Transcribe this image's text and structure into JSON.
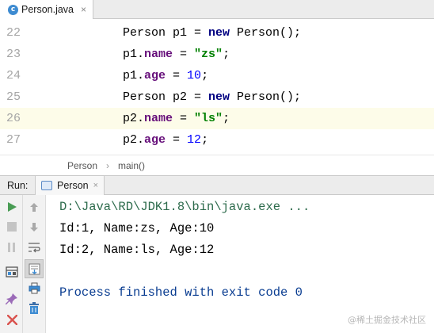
{
  "editor_tab": {
    "icon": "java-class-icon",
    "icon_letter": "c",
    "label": "Person.java",
    "close": "×"
  },
  "editor": {
    "lines": [
      {
        "num": "22",
        "tokens": [
          {
            "t": "Person p1 = ",
            "c": ""
          },
          {
            "t": "new",
            "c": "kw"
          },
          {
            "t": " Person();",
            "c": ""
          }
        ]
      },
      {
        "num": "23",
        "tokens": [
          {
            "t": "p1.",
            "c": ""
          },
          {
            "t": "name",
            "c": "fld"
          },
          {
            "t": " = ",
            "c": ""
          },
          {
            "t": "\"zs\"",
            "c": "str"
          },
          {
            "t": ";",
            "c": ""
          }
        ]
      },
      {
        "num": "24",
        "tokens": [
          {
            "t": "p1.",
            "c": ""
          },
          {
            "t": "age",
            "c": "fld"
          },
          {
            "t": " = ",
            "c": ""
          },
          {
            "t": "10",
            "c": "num"
          },
          {
            "t": ";",
            "c": ""
          }
        ]
      },
      {
        "num": "25",
        "tokens": [
          {
            "t": "Person p2 = ",
            "c": ""
          },
          {
            "t": "new",
            "c": "kw"
          },
          {
            "t": " Person();",
            "c": ""
          }
        ]
      },
      {
        "num": "26",
        "tokens": [
          {
            "t": "p2.",
            "c": ""
          },
          {
            "t": "name",
            "c": "fld"
          },
          {
            "t": " = ",
            "c": ""
          },
          {
            "t": "\"ls\"",
            "c": "str"
          },
          {
            "t": ";",
            "c": ""
          }
        ],
        "current": true
      },
      {
        "num": "27",
        "tokens": [
          {
            "t": "p2.",
            "c": ""
          },
          {
            "t": "age",
            "c": "fld"
          },
          {
            "t": " = ",
            "c": ""
          },
          {
            "t": "12",
            "c": "num"
          },
          {
            "t": ";",
            "c": ""
          }
        ]
      }
    ]
  },
  "breadcrumb": {
    "class": "Person",
    "separator": "›",
    "method": "main()"
  },
  "run_window": {
    "label": "Run:",
    "tab_label": "Person",
    "tab_close": "×",
    "console": {
      "command": "D:\\Java\\RD\\JDK1.8\\bin\\java.exe ...",
      "output": [
        "Id:1, Name:zs, Age:10",
        "Id:2, Name:ls, Age:12"
      ],
      "exit_message": "Process finished with exit code 0"
    }
  },
  "watermark": "@稀土掘金技术社区",
  "colors": {
    "keyword": "#000080",
    "field": "#660e7a",
    "string": "#008000",
    "number": "#0000ff",
    "current_line": "#fdfce9",
    "run_green": "#499c54",
    "stop_red": "#d9534f"
  }
}
